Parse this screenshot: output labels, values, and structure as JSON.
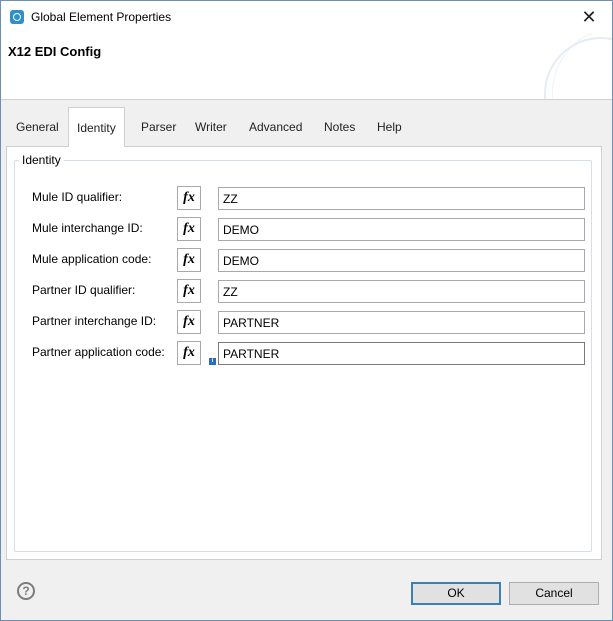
{
  "window": {
    "title": "Global Element Properties",
    "close_glyph": "✕"
  },
  "header": {
    "title": "X12 EDI Config"
  },
  "tabs": [
    {
      "label": "General",
      "active": false
    },
    {
      "label": "Identity",
      "active": true
    },
    {
      "label": "Parser",
      "active": false
    },
    {
      "label": "Writer",
      "active": false
    },
    {
      "label": "Advanced",
      "active": false
    },
    {
      "label": "Notes",
      "active": false
    },
    {
      "label": "Help",
      "active": false
    }
  ],
  "identity": {
    "group_label": "Identity",
    "fx_label": "fx",
    "info_glyph": "i",
    "fields": [
      {
        "label": "Mule ID qualifier:",
        "value": "ZZ"
      },
      {
        "label": "Mule interchange ID:",
        "value": "DEMO"
      },
      {
        "label": "Mule application code:",
        "value": "DEMO"
      },
      {
        "label": "Partner ID qualifier:",
        "value": "ZZ"
      },
      {
        "label": "Partner interchange ID:",
        "value": "PARTNER"
      },
      {
        "label": "Partner application code:",
        "value": "PARTNER"
      }
    ]
  },
  "footer": {
    "help_glyph": "?",
    "ok_label": "OK",
    "cancel_label": "Cancel"
  },
  "colors": {
    "window_border": "#6d8fb3",
    "default_button_border": "#3c7fb1",
    "app_icon": "#2f8fc9"
  },
  "icons": {
    "app": "mule-app-icon",
    "close": "close-icon",
    "help": "help-icon",
    "info": "info-icon"
  }
}
